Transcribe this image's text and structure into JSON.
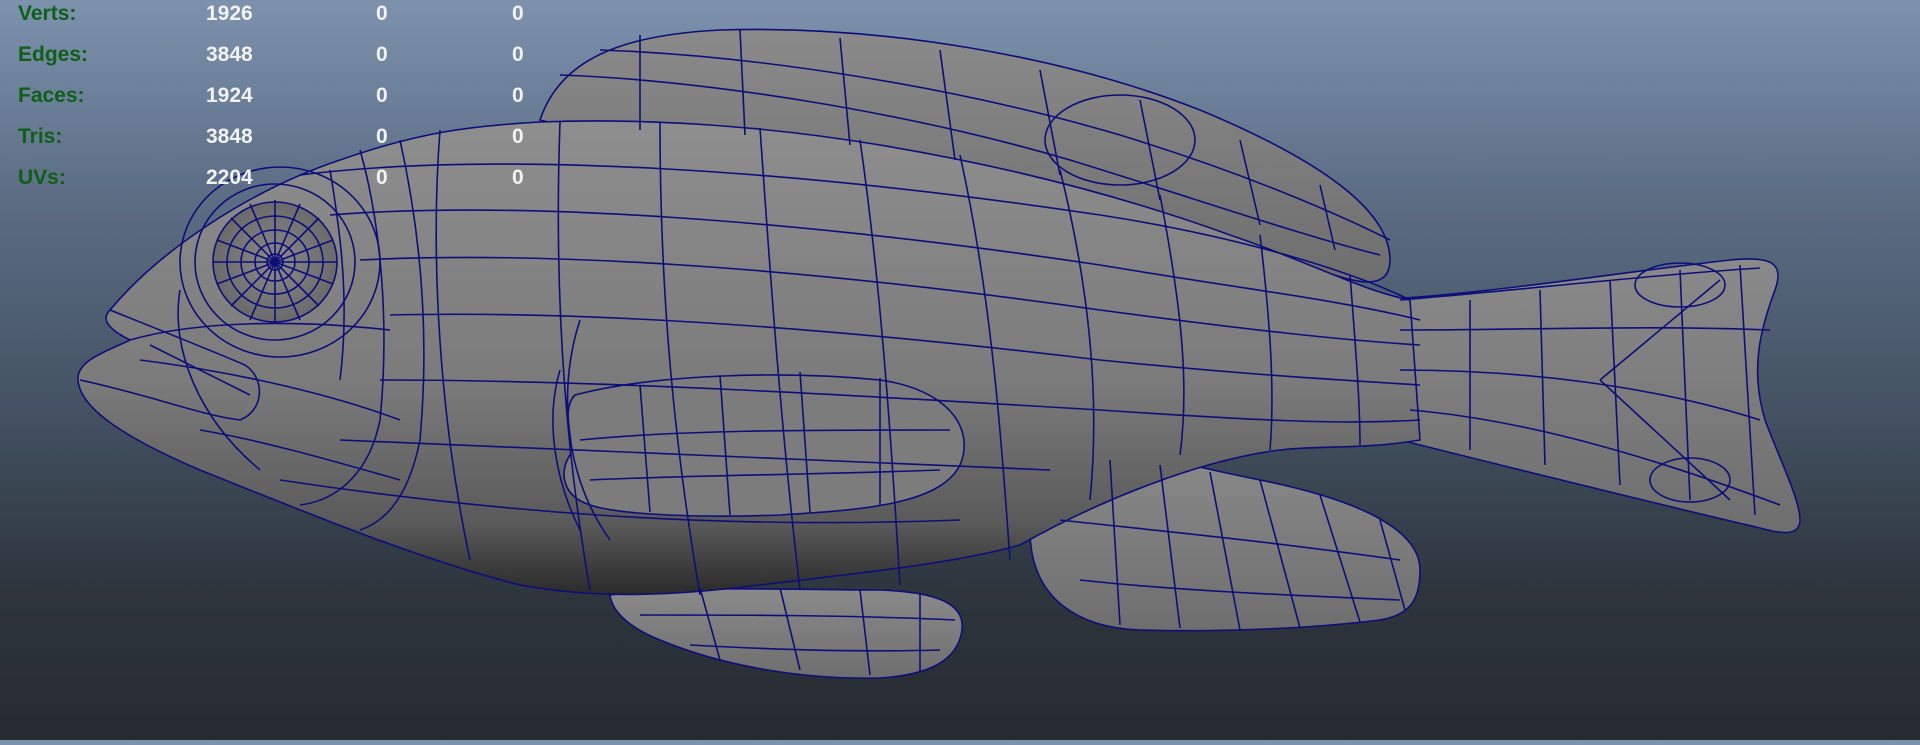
{
  "hud": {
    "rows": [
      {
        "label": "Verts:",
        "total": "1926",
        "selected": "0",
        "component": "0"
      },
      {
        "label": "Edges:",
        "total": "3848",
        "selected": "0",
        "component": "0"
      },
      {
        "label": "Faces:",
        "total": "1924",
        "selected": "0",
        "component": "0"
      },
      {
        "label": "Tris:",
        "total": "3848",
        "selected": "0",
        "component": "0"
      },
      {
        "label": "UVs:",
        "total": "2204",
        "selected": "0",
        "component": "0"
      }
    ]
  },
  "colors": {
    "wire": "#0e0e7a",
    "mesh": "#7f7f7f",
    "hud_label": "#0f5f1a",
    "hud_value": "#f2f2f2"
  },
  "viewport": {
    "model": "fish-wireframe-mesh"
  }
}
